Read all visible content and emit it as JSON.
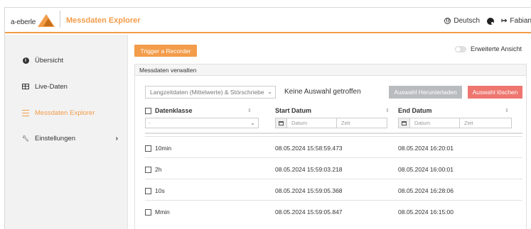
{
  "header": {
    "logo_text": "a-eberle",
    "app_title": "Messdaten Explorer",
    "language": "Deutsch",
    "user": "Fabian"
  },
  "sidebar": {
    "items": [
      {
        "label": "Übersicht",
        "icon": "info-icon"
      },
      {
        "label": "Live-Daten",
        "icon": "table-icon"
      },
      {
        "label": "Messdaten Explorer",
        "icon": "list-icon",
        "active": true
      },
      {
        "label": "Einstellungen",
        "icon": "wrench-icon",
        "chevron": "›"
      }
    ]
  },
  "main": {
    "trigger_label": "Trigger a Recorder",
    "toggle_label": "Erweiterte Ansicht",
    "panel_title": "Messdaten verwalten",
    "data_select": "Langzeitdaten (Mittelwerte) & Störschriebe",
    "selection_status": "Keine Auswahl getroffen",
    "download_label": "Auswahl Herunterladen",
    "clear_label": "Auswahl löschen",
    "columns": {
      "datenklasse": "Datenklasse",
      "start": "Start Datum",
      "end": "End Datum"
    },
    "filters": {
      "datenklasse_value": "-",
      "start_date_placeholder": "Datum",
      "start_time_placeholder": "Zeit",
      "end_date_placeholder": "Datum",
      "end_time_placeholder": "Zeit"
    },
    "rows": [
      {
        "klasse": "10min",
        "start": "08.05.2024 15:58:59.473",
        "end": "08.05.2024 16:20:01"
      },
      {
        "klasse": "2h",
        "start": "08.05.2024 15:59:03.218",
        "end": "08.05.2024 16:00:01"
      },
      {
        "klasse": "10s",
        "start": "08.05.2024 15:59:05.368",
        "end": "08.05.2024 16:28:06"
      },
      {
        "klasse": "Mmin",
        "start": "08.05.2024 15:59:05.847",
        "end": "08.05.2024 16:15:00"
      }
    ]
  },
  "colors": {
    "accent": "#f39c4a",
    "danger": "#ee766f",
    "disabled": "#b8bcbf"
  }
}
